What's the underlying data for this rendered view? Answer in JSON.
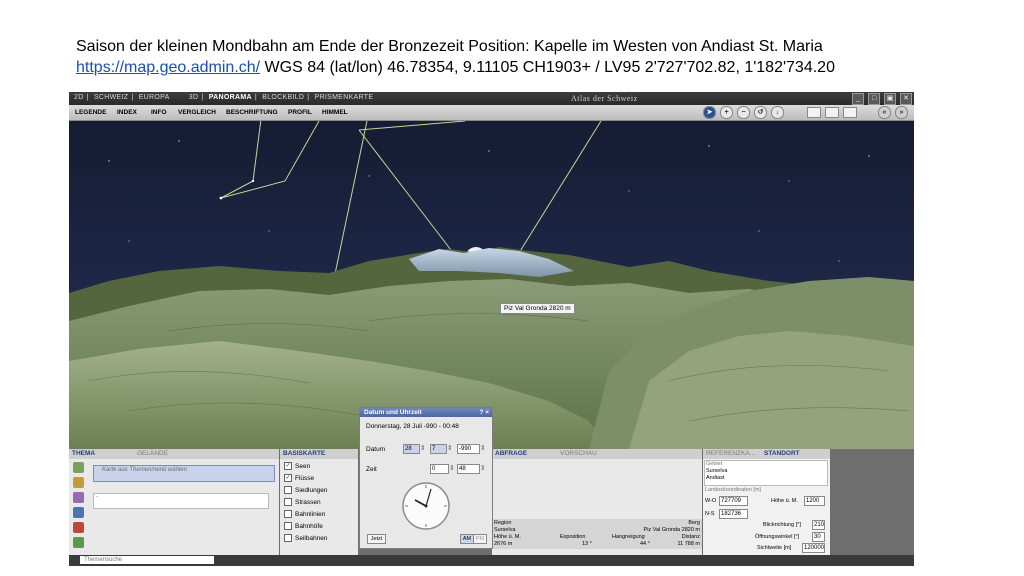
{
  "caption": {
    "line1": "Saison der kleinen Mondbahn  am Ende der Bronzezeit Position: Kapelle im Westen von Andiast St. Maria",
    "link": "https://map.geo.admin.ch/",
    "line2_rest": "  WGS 84 (lat/lon)  46.78354, 9.11105  CH1903+ / LV95  2'727'702.82, 1'182'734.20"
  },
  "titlebar": {
    "nav": [
      "2D",
      "SCHWEIZ",
      "EUROPA",
      "3D",
      "PANORAMA",
      "BLOCKBILD",
      "PRISMENKARTE"
    ],
    "active": "PANORAMA",
    "app_title": "Atlas der Schweiz"
  },
  "menu": [
    "LEGENDE",
    "INDEX",
    "INFO",
    "VERGLEICH",
    "BESCHRIFTUNG",
    "PROFIL",
    "HIMMEL"
  ],
  "scene": {
    "peak_label": "Piz Val Gronda   2820 m"
  },
  "thema": {
    "tab_active": "THEMA",
    "tab_inactive": "GELÄNDE",
    "select_placeholder": "Karte aus Themenmenü wählen",
    "select2": "-"
  },
  "basiskarte": {
    "tab": "BASISKARTE",
    "layers": [
      {
        "label": "Seen",
        "checked": true
      },
      {
        "label": "Flüsse",
        "checked": true
      },
      {
        "label": "Siedlungen",
        "checked": false
      },
      {
        "label": "Strassen",
        "checked": false
      },
      {
        "label": "Bahnlinien",
        "checked": false
      },
      {
        "label": "Bahnhöfe",
        "checked": false
      },
      {
        "label": "Seilbahnen",
        "checked": false
      }
    ]
  },
  "dialog": {
    "title": "Datum und Uhrzeit",
    "help": "?",
    "close": "×",
    "date_text": "Donnerstag, 28 Juli -990 - 00:48",
    "datum_label": "Datum",
    "day": "28",
    "month": "7",
    "year": "-990",
    "zeit_label": "Zeit",
    "hour": "0",
    "minute": "48",
    "jetzt": "Jetzt",
    "am": "AM",
    "pm": "PM"
  },
  "abfrage": {
    "tab_active": "ABFRAGE",
    "tab_inactive": "VORSCHAU",
    "region_label": "Region",
    "berg_label": "Berg",
    "region_value": "Surselva",
    "berg_value": "Piz Val Gronda   2820 m",
    "col_labels": [
      "Höhe ü. M.",
      "Exposition",
      "Hangneigung",
      "Distanz"
    ],
    "col_values": [
      "2676 m",
      "13 °",
      "44 °",
      "11 788 m"
    ]
  },
  "standort": {
    "tab_inactive": "REFERENZKA...",
    "tab_active": "STANDORT",
    "gebiet_label": "Gebiet",
    "gebiet_values": [
      "Surselva",
      "Andiast"
    ],
    "koord_label": "Landeskoordinaten [m]",
    "wo_label": "W-O",
    "wo_value": "727709",
    "ns_label": "N-S",
    "ns_value": "182736",
    "hoehe_label": "Höhe ü. M.",
    "hoehe_value": "1200",
    "blick_label": "Blickrichtung [°]",
    "blick_value": "210",
    "oeffnung_label": "Öffnungswinkel [°]",
    "oeffnung_value": "30",
    "sicht_label": "Sichtweite [m]",
    "sicht_value": "120000"
  },
  "status": {
    "search_placeholder": "Themensuche"
  },
  "colors": {
    "sky": "#1c2541",
    "accent": "#1f3f86",
    "dialog_header": "#5670ad"
  }
}
